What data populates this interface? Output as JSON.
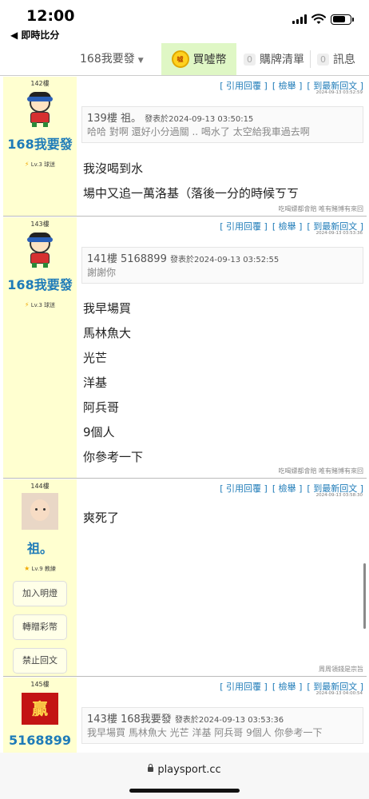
{
  "status_bar": {
    "time": "12:00",
    "back_app": "◀ 即時比分"
  },
  "nav": {
    "user_label": "168我要發",
    "buy_label": "買噓幣",
    "coin_icon_text": "噓",
    "orders_count": "0",
    "orders_label": "購牌清單",
    "messages_count": "0",
    "messages_label": "訊息"
  },
  "actions": {
    "quote_reply": "[ 引用回覆 ]",
    "report": "[ 檢舉 ]",
    "latest_reply": "[ 到最新回文 ]"
  },
  "side_buttons": {
    "light": "加入明燈",
    "gift": "轉贈彩幣",
    "ban": "禁止回文"
  },
  "posts": [
    {
      "floor": "142樓",
      "user": "168我要發",
      "level": "Lv.3 球迷",
      "time": "2024-09-13 03:52:59",
      "quote": {
        "header": "139樓 祖。",
        "date": "發表於2024-09-13 03:50:15",
        "text": "哈哈 對啊 還好小分過關 .. 喝水了 太空給我車過去啊"
      },
      "lines": [
        "我沒喝到水",
        "場中又追一萬洛基（落後一分的時候ㄎㄎ"
      ],
      "signature": "吃喝嫖都會賠 唯有賭博有來回"
    },
    {
      "floor": "143樓",
      "user": "168我要發",
      "level": "Lv.3 球迷",
      "time": "2024-09-13 03:53:36",
      "quote": {
        "header": "141樓 5168899",
        "date": "發表於2024-09-13 03:52:55",
        "text": "謝謝你"
      },
      "lines": [
        "我早場買",
        "馬林魚大",
        "光芒",
        "洋基",
        "阿兵哥",
        "9個人",
        "你參考一下"
      ],
      "signature": "吃喝嫖都會賠 唯有賭博有來回"
    },
    {
      "floor": "144樓",
      "user": "祖。",
      "level": "Lv.9 教練",
      "time": "2024-09-13 03:58:30",
      "lines": [
        "爽死了"
      ],
      "signature": "周周領錢是宗旨"
    },
    {
      "floor": "145樓",
      "user": "5168899",
      "avatar_text": "贏",
      "time": "2024-09-13 04:00:54",
      "quote": {
        "header": "143樓 168我要發",
        "date": "發表於2024-09-13 03:53:36",
        "text": "我早場買 馬林魚大 光芒 洋基 阿兵哥 9個人 你參考一下"
      }
    }
  ],
  "url": "playsport.cc"
}
